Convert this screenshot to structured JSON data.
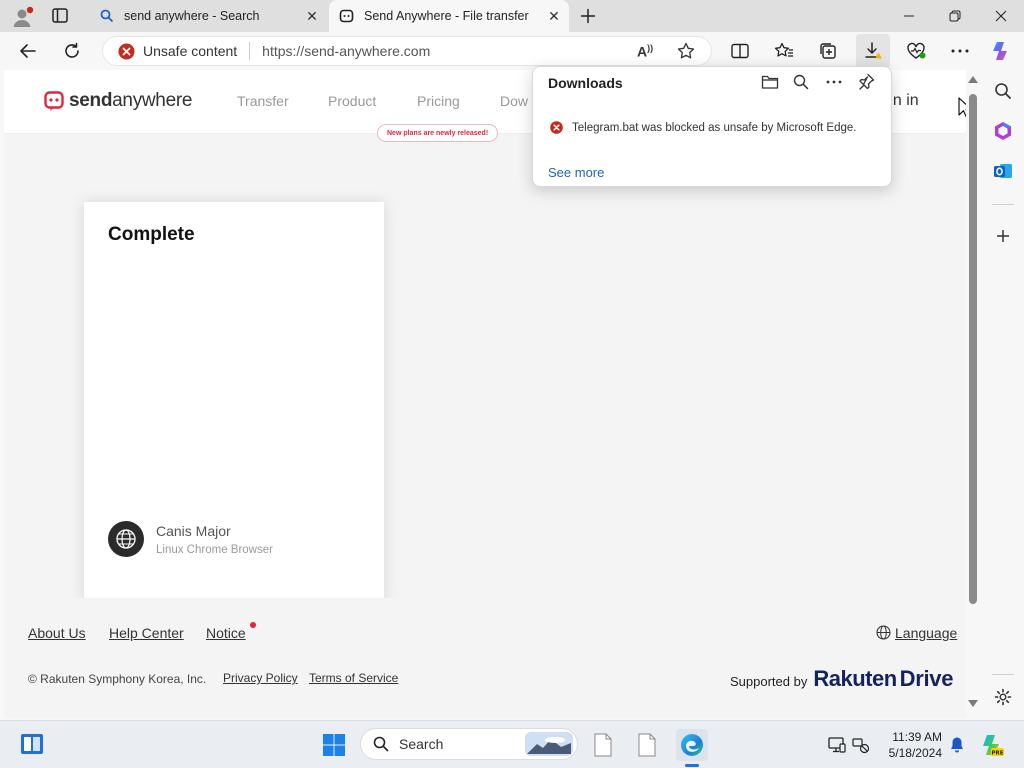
{
  "browser": {
    "tabs": [
      {
        "title": "send anywhere - Search",
        "active": false
      },
      {
        "title": "Send Anywhere - File transfer",
        "active": true
      }
    ],
    "address": {
      "security_label": "Unsafe content",
      "url": "https://send-anywhere.com"
    }
  },
  "site": {
    "logo_send": "send",
    "logo_anywhere": "anywhere",
    "nav": {
      "transfer": "Transfer",
      "product": "Product",
      "pricing": "Pricing",
      "downloads_partial": "Dow",
      "signin_partial": "gn in"
    },
    "badge": "New plans are newly released!",
    "card": {
      "title": "Complete",
      "device_name": "Canis Major",
      "device_desc": "Linux Chrome Browser"
    },
    "footer": {
      "about": "About Us",
      "help": "Help Center",
      "notice": "Notice",
      "language": "Language",
      "copyright": "© Rakuten Symphony Korea, Inc.",
      "privacy": "Privacy Policy",
      "terms": "Terms of Service",
      "supported_by": "Supported by",
      "brand_rakuten": "Rakuten",
      "brand_drive": "Drive"
    }
  },
  "downloads_panel": {
    "title": "Downloads",
    "message": "Telegram.bat was blocked as unsafe by Microsoft Edge.",
    "see_more": "See more"
  },
  "taskbar": {
    "search_placeholder": "Search",
    "time": "11:39 AM",
    "date": "5/18/2024"
  },
  "colors": {
    "brand_red": "#e0263f",
    "link_blue": "#1a64c8",
    "rakuten_navy": "#13245c",
    "error_red": "#c42b1c"
  }
}
